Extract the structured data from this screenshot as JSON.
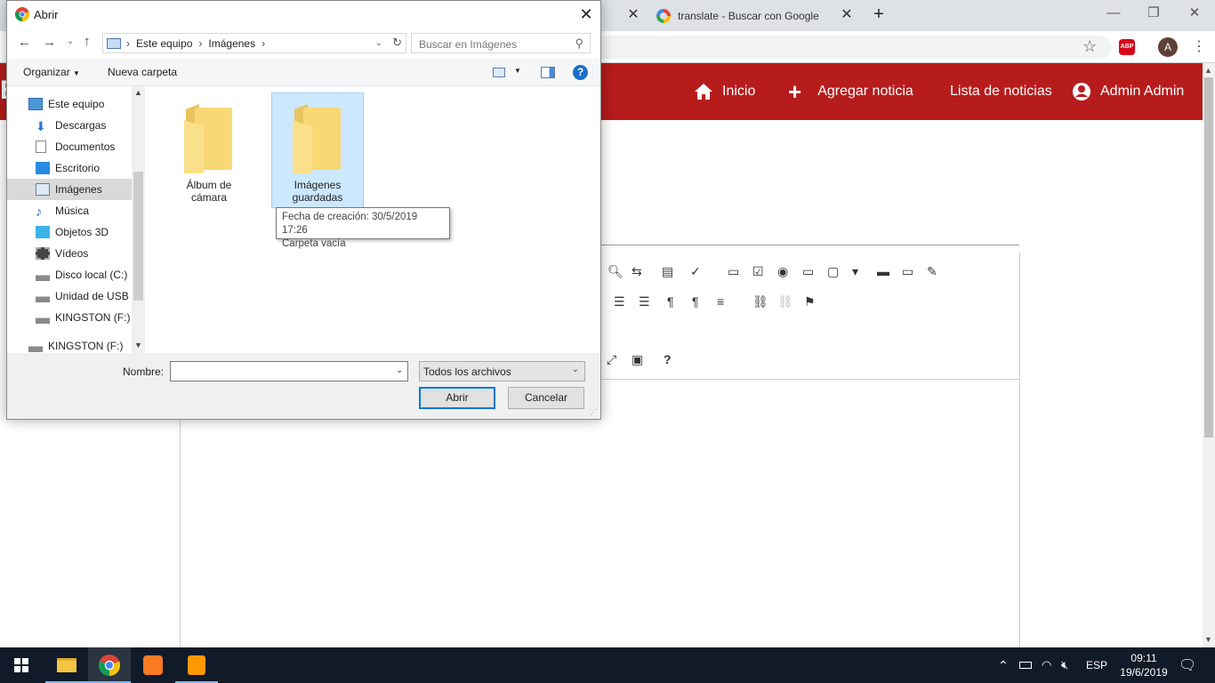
{
  "browser": {
    "tabs": [
      {
        "label": ""
      },
      {
        "label": "translate - Buscar con Google"
      }
    ],
    "new_tab": "+",
    "abp_label": "ABP",
    "profile_initial": "A"
  },
  "site": {
    "brand_letter": "E",
    "nav": {
      "home": "Inicio",
      "add": "Agregar noticia",
      "list": "Lista de noticias",
      "user": "Admin Admin"
    }
  },
  "dialog": {
    "title": "Abrir",
    "breadcrumb": [
      "Este equipo",
      "Imágenes"
    ],
    "search_placeholder": "Buscar en Imágenes",
    "organize": "Organizar",
    "new_folder": "Nueva carpeta",
    "help": "?",
    "nav_items": [
      {
        "label": "Este equipo",
        "icon": "computer-icon"
      },
      {
        "label": "Descargas",
        "icon": "download-icon"
      },
      {
        "label": "Documentos",
        "icon": "document-icon"
      },
      {
        "label": "Escritorio",
        "icon": "desktop-icon"
      },
      {
        "label": "Imágenes",
        "icon": "pictures-icon"
      },
      {
        "label": "Música",
        "icon": "music-icon"
      },
      {
        "label": "Objetos 3D",
        "icon": "cube-icon"
      },
      {
        "label": "Vídeos",
        "icon": "video-icon"
      },
      {
        "label": "Disco local (C:)",
        "icon": "drive-icon"
      },
      {
        "label": "Unidad de USB (",
        "icon": "usb-icon"
      },
      {
        "label": "KINGSTON (F:)",
        "icon": "usb-icon"
      },
      {
        "label": "KINGSTON (F:)",
        "icon": "usb-icon"
      }
    ],
    "folders": [
      {
        "line1": "Álbum de",
        "line2": "cámara"
      },
      {
        "line1": "Imágenes",
        "line2": "guardadas"
      }
    ],
    "tooltip": {
      "line1": "Fecha de creación: 30/5/2019 17:26",
      "line2": "Carpeta vacía"
    },
    "name_label": "Nombre:",
    "name_value": "",
    "file_type": "Todos los archivos",
    "open": "Abrir",
    "cancel": "Cancelar"
  },
  "taskbar": {
    "lang": "ESP",
    "time": "09:11",
    "date": "19/6/2019"
  }
}
